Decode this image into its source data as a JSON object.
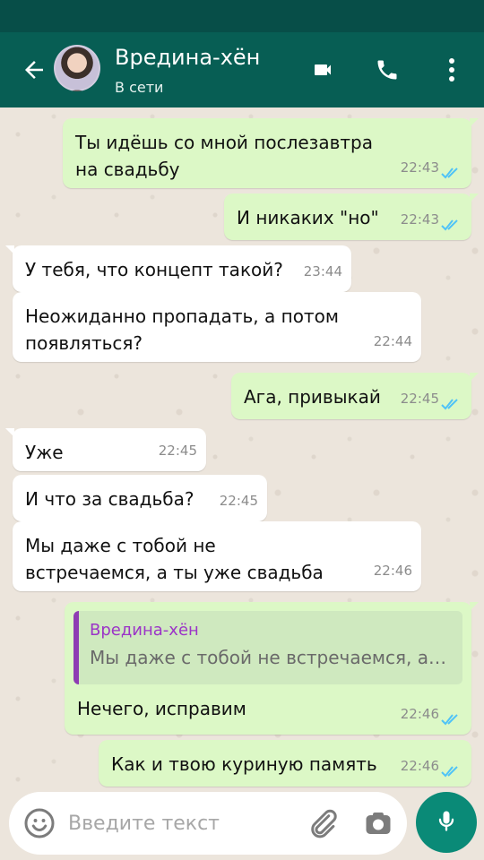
{
  "header": {
    "back_icon": "arrow-left",
    "contact_name": "Вредина-хён",
    "contact_status": "В сети",
    "video_icon": "video-camera",
    "call_icon": "phone",
    "menu_icon": "more-vertical"
  },
  "colors": {
    "header": "#075e54",
    "statusbar": "#074e48",
    "outgoing": "#dcf8c6",
    "incoming": "#ffffff",
    "read_ticks": "#4fc3f7",
    "reply_name": "#9b34c7",
    "mic_button": "#0a8a77"
  },
  "messages": [
    {
      "direction": "out",
      "text": "Ты идёшь со мной послезавтра на свадьбу",
      "time": "22:43",
      "read": true
    },
    {
      "direction": "out",
      "text": "И никаких \"но\"",
      "time": "22:43",
      "read": true
    },
    {
      "direction": "in",
      "text": "У тебя, что концепт такой?",
      "time": "23:44"
    },
    {
      "direction": "in",
      "text": "Неожиданно пропадать, а потом появляться?",
      "time": "22:44"
    },
    {
      "direction": "out",
      "text": "Ага, привыкай",
      "time": "22:45",
      "read": true
    },
    {
      "direction": "in",
      "text": "Уже",
      "time": "22:45"
    },
    {
      "direction": "in",
      "text": "И что за свадьба?",
      "time": "22:45"
    },
    {
      "direction": "in",
      "text": "Мы даже с тобой не встречаемся, а ты уже свадьба",
      "time": "22:46"
    },
    {
      "direction": "out",
      "reply_to": {
        "name": "Вредина-хён",
        "text": "Мы даже с тобой не встречаемся, а т..."
      },
      "text": "Нечего, исправим",
      "time": "22:46",
      "read": true
    },
    {
      "direction": "out",
      "text": "Как и твою куриную память",
      "time": "22:46",
      "read": true
    }
  ],
  "composer": {
    "placeholder": "Введите текст",
    "emoji_icon": "emoji",
    "attach_icon": "paperclip",
    "camera_icon": "camera",
    "mic_icon": "microphone"
  }
}
